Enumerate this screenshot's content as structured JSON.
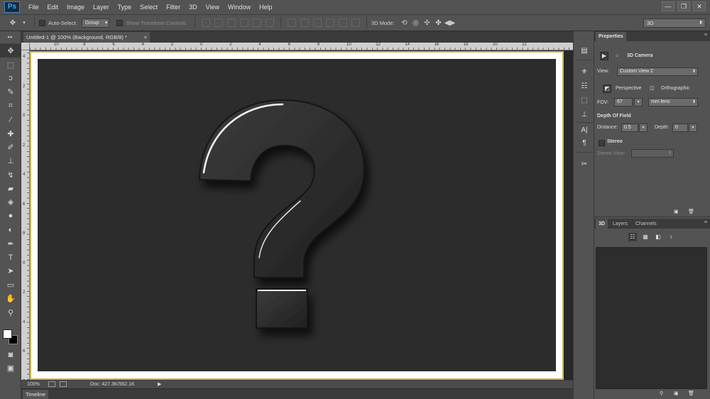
{
  "app": {
    "logo": "Ps"
  },
  "menu": [
    "File",
    "Edit",
    "Image",
    "Layer",
    "Type",
    "Select",
    "Filter",
    "3D",
    "View",
    "Window",
    "Help"
  ],
  "window_controls": {
    "minimize": "—",
    "restore": "❐",
    "close": "✕"
  },
  "options_bar": {
    "auto_select_label": "Auto-Select:",
    "auto_select_value": "Group",
    "show_transform_label": "Show Transform Controls",
    "mode_label": "3D Mode:",
    "workspace": "3D"
  },
  "document": {
    "tab_title": "Untitled-1 @ 100% (Background, RGB/8) *",
    "tab_close": "×",
    "zoom": "100%",
    "doc_size": "Doc: 427.3K/562.1K",
    "status_arrow": "▶"
  },
  "rulers": {
    "top_ticks": [
      "10",
      "8",
      "6",
      "4",
      "2",
      "0",
      "2",
      "4",
      "6",
      "8",
      "10",
      "12",
      "14",
      "16",
      "18",
      "20",
      "22"
    ],
    "left_ticks": [
      "4",
      "2",
      "0",
      "2",
      "4",
      "6",
      "8",
      "0",
      "2",
      "4",
      "6",
      "8"
    ]
  },
  "timeline": {
    "label": "Timeline"
  },
  "properties": {
    "tab": "Properties",
    "section": "3D Camera",
    "view_label": "View:",
    "view_value": "Custom View 2",
    "perspective": "Perspective",
    "orthographic": "Orthographic",
    "fov_label": "FOV:",
    "fov_value": "67",
    "fov_unit": "mm lens",
    "dof_title": "Depth Of Field",
    "distance_label": "Distance:",
    "distance_value": "0.5",
    "depth_label": "Depth:",
    "depth_value": "0",
    "stereo_label": "Stereo",
    "stereo_view_label": "Stereo View:"
  },
  "layers_panel": {
    "tabs": [
      "3D",
      "Layers",
      "Channels"
    ]
  },
  "colors": {
    "foreground": "#ffffff",
    "background": "#000000",
    "canvas": "#2c2c2c",
    "frame": "#c8b552"
  }
}
